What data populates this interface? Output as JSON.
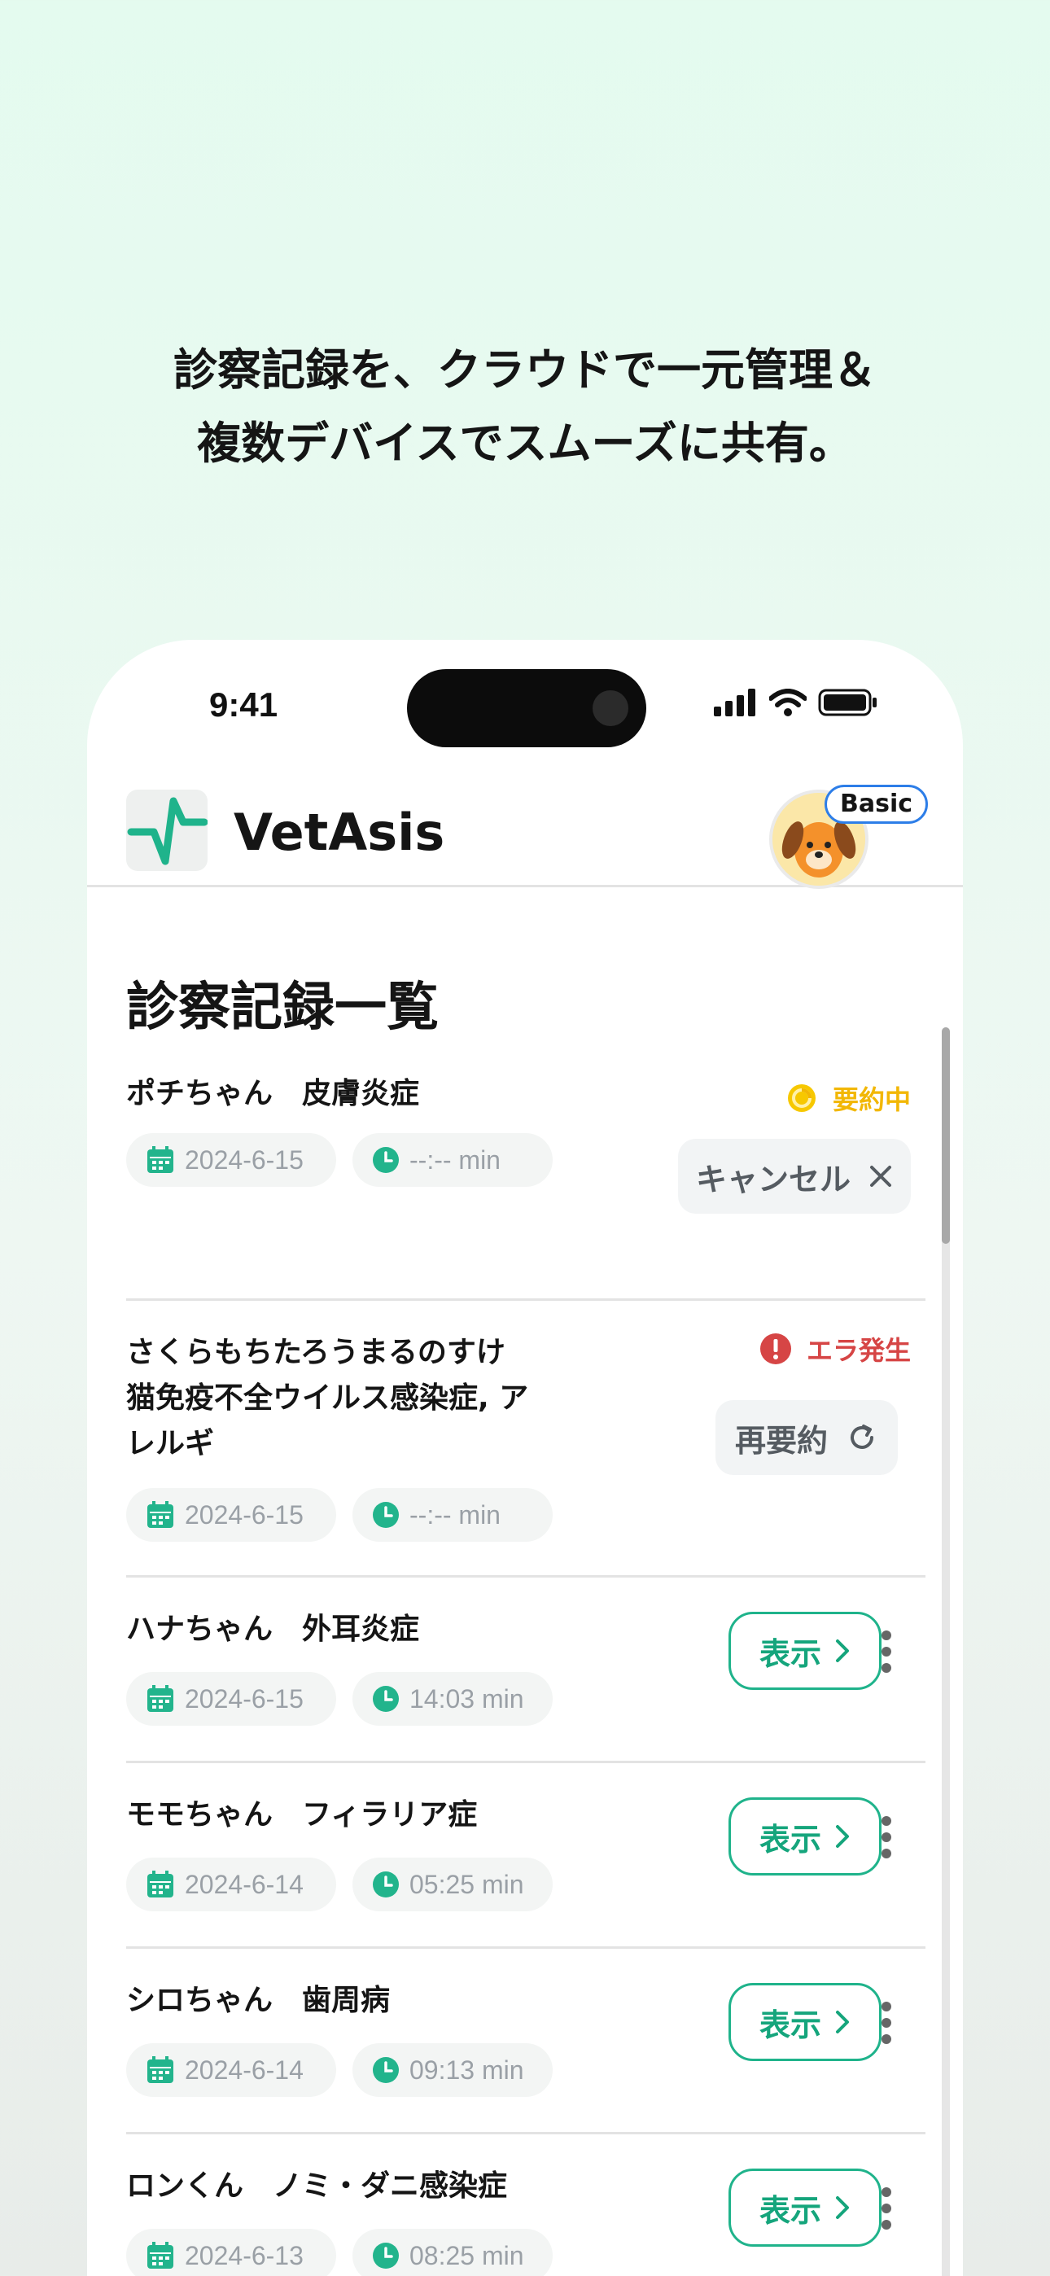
{
  "headline": {
    "line1": "診察記録を、クラウドで一元管理＆",
    "line2": "複数デバイスでスムーズに共有。"
  },
  "status_bar": {
    "time": "9:41"
  },
  "app": {
    "title": "VetAsis",
    "plan_badge": "Basic"
  },
  "page_title": "診察記録一覧",
  "records": [
    {
      "title": "ポチちゃん　皮膚炎症",
      "date": "2024-6-15",
      "duration": "--:-- min",
      "status": "要約中",
      "action": "キャンセル"
    },
    {
      "title_lines": [
        "さくらもちたろうまるのすけ",
        "猫免疫不全ウイルス感染症, ア",
        "レルギ"
      ],
      "date": "2024-6-15",
      "duration": "--:-- min",
      "status": "エラ発生",
      "action": "再要約"
    },
    {
      "title": "ハナちゃん　外耳炎症",
      "date": "2024-6-15",
      "duration": "14:03 min",
      "action": "表示"
    },
    {
      "title": "モモちゃん　フィラリア症",
      "date": "2024-6-14",
      "duration": "05:25 min",
      "action": "表示"
    },
    {
      "title": "シロちゃん　歯周病",
      "date": "2024-6-14",
      "duration": "09:13 min",
      "action": "表示"
    },
    {
      "title": "ロンくん　ノミ・ダニ感染症",
      "date": "2024-6-13",
      "duration": "08:25 min",
      "action": "表示"
    }
  ],
  "colors": {
    "accent": "#1fb38b",
    "processing": "#f2b705",
    "error": "#d64545",
    "chip_icon": "#22b48c"
  }
}
